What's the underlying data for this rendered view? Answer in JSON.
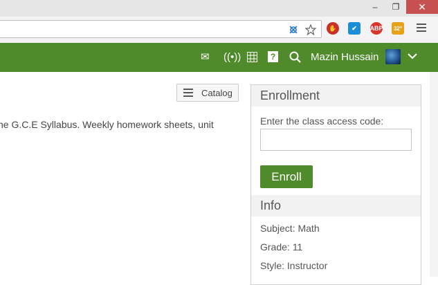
{
  "window": {
    "minimize": "–",
    "restore": "❐",
    "close": "✕"
  },
  "toolbar": {
    "badge_weather": "32°",
    "badge_abp": "ABP"
  },
  "appbar": {
    "username": "Mazin Hussain",
    "icons": [
      "mail-icon",
      "broadcast-icon",
      "calendar-icon",
      "help-icon",
      "search-icon",
      "avatar",
      "chevron-down-icon"
    ]
  },
  "content": {
    "catalog_label": "Catalog",
    "description": "he G.C.E Syllabus. Weekly homework sheets, unit"
  },
  "enrollment": {
    "title": "Enrollment",
    "access_label": "Enter the class access code:",
    "access_value": "",
    "enroll_label": "Enroll"
  },
  "info": {
    "title": "Info",
    "subject": "Subject: Math",
    "grade": "Grade: 11",
    "style": "Style: Instructor"
  },
  "colors": {
    "brand": "#4f8b2b",
    "panel_head": "#f2f2f2"
  }
}
